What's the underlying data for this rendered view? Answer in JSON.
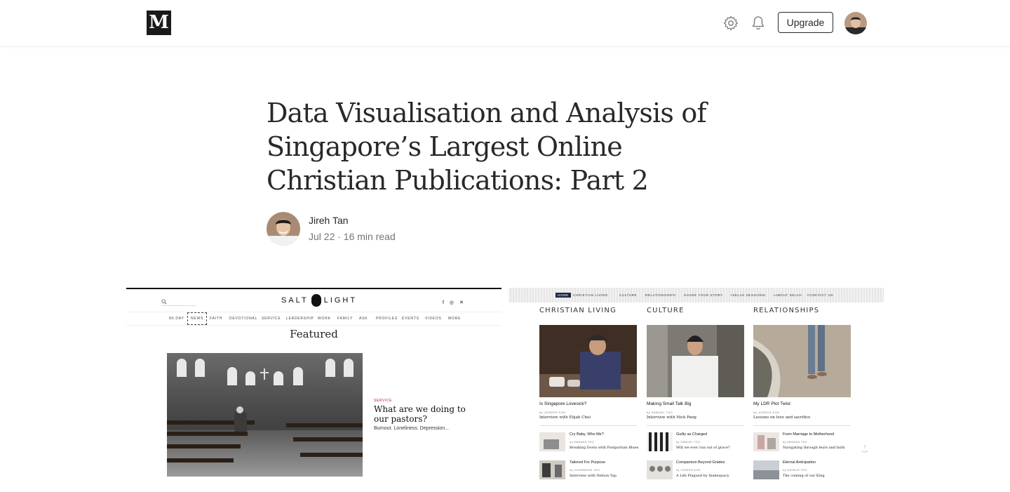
{
  "topbar": {
    "logo": "M",
    "upgrade_label": "Upgrade"
  },
  "article": {
    "title": "Data Visualisation and Analysis of Singapore’s Largest Online Christian Publications: Part 2",
    "author": "Jireh Tan",
    "meta": "Jul 22 · 16 min read"
  },
  "salt_light": {
    "logo_left": "SALT",
    "logo_right": "LIGHT",
    "social": "f ◎ ✕",
    "nav": [
      "80.DAY",
      "NEWS",
      "FAITH",
      "DEVOTIONAL",
      "SERVICE",
      "LEADERSHIP",
      "WORK",
      "FAMILY",
      "ASK",
      "PROFILES",
      "EVENTS",
      "VIDEOS",
      "MORE"
    ],
    "featured": "Featured",
    "kicker": "SERVICE",
    "headline": "What are we doing to our pastors?",
    "dek": "Burnout. Loneliness. Depression..."
  },
  "selah": {
    "nav": [
      "HOME",
      "CHRISTIAN LIVING",
      "CULTURE",
      "RELATIONSHIPS",
      "SHARE YOUR STORY",
      "+SELAH SESSIONS",
      "+ABOUT SELAH",
      "+CONTACT US"
    ],
    "columns": [
      {
        "title": "CHRISTIAN LIVING",
        "headline": "Is Singapore Lovesick?",
        "byline": "by JOSEPH KOH",
        "dek": "Interview with Elijah Choi",
        "items": [
          {
            "headline": "Cry Baby, Who Me?",
            "byline": "by AMANDA TEO",
            "dek": "Breaking Down with Postpartum Blues"
          },
          {
            "headline": "Tailored For Purpose",
            "byline": "by CHARMAINE YEO",
            "dek": "Interview with Nelson Yap"
          }
        ]
      },
      {
        "title": "CULTURE",
        "headline": "Making Small Talk Big",
        "byline": "by SAMUEL TEO",
        "dek": "Interview with Nick Pang",
        "items": [
          {
            "headline": "Guilty as Charged",
            "byline": "by SAMUEL TEO",
            "dek": "Will we ever run out of grace?"
          },
          {
            "headline": "Comparison Beyond Grades",
            "byline": "by JOSEPH KOH",
            "dek": "A Life Plagued by Inadequacy"
          }
        ]
      },
      {
        "title": "RELATIONSHIPS",
        "headline": "My LDR Plot Twist",
        "byline": "by JOSEPH KOH",
        "dek": "Lessons on love and sacrifice",
        "items": [
          {
            "headline": "From Marriage to Motherhood",
            "byline": "by AMANDA TEO",
            "dek": "Navigating through fears and faith"
          },
          {
            "headline": "Eternal Anticipation",
            "byline": "by NATALIE TEO",
            "dek": "The coming of our King"
          }
        ]
      }
    ],
    "top_arrow": "↑",
    "top_label": "TOP"
  }
}
